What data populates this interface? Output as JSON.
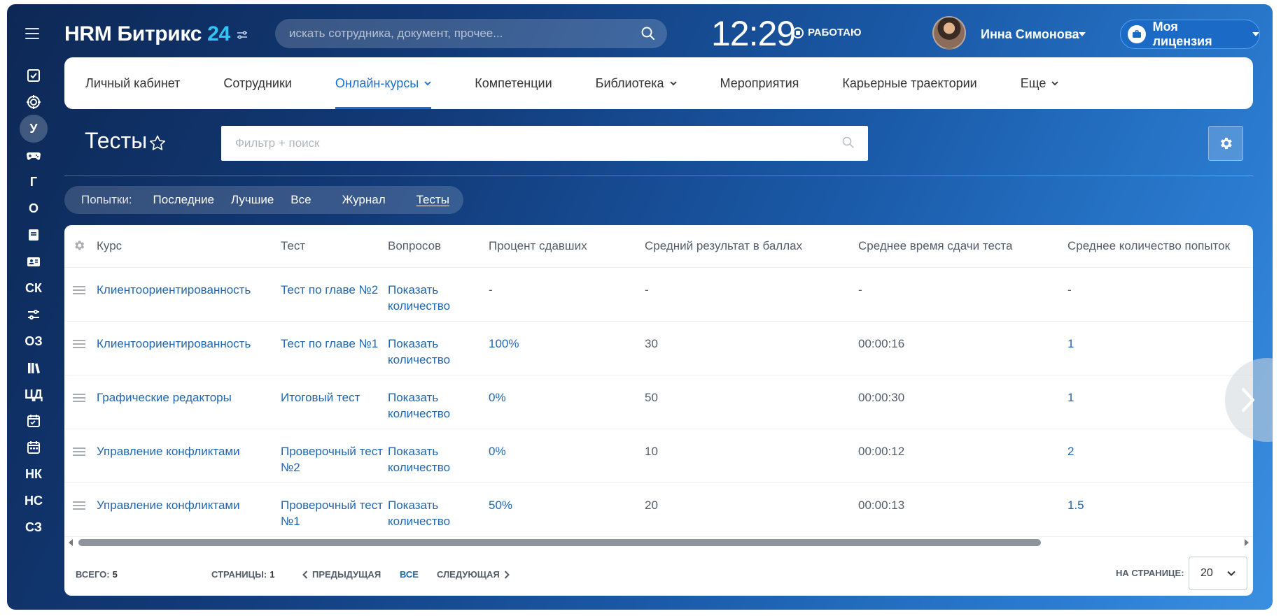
{
  "header": {
    "logo_text": "HRM Битрикс",
    "logo_num": "24",
    "search_placeholder": "искать сотрудника, документ, прочее...",
    "clock": "12:29",
    "work_status": "РАБОТАЮ",
    "user_name": "Инна Симонова",
    "license": "Моя лицензия"
  },
  "sidebar": {
    "items": [
      {
        "type": "icon",
        "icon": "checkbox-icon"
      },
      {
        "type": "icon",
        "icon": "target-icon"
      },
      {
        "type": "text",
        "label": "У",
        "active": true
      },
      {
        "type": "icon",
        "icon": "gamepad-icon"
      },
      {
        "type": "text",
        "label": "Г"
      },
      {
        "type": "text",
        "label": "О"
      },
      {
        "type": "icon",
        "icon": "document-icon"
      },
      {
        "type": "icon",
        "icon": "id-card-icon"
      },
      {
        "type": "text",
        "label": "СК"
      },
      {
        "type": "icon",
        "icon": "sliders-icon"
      },
      {
        "type": "text",
        "label": "ОЗ"
      },
      {
        "type": "icon",
        "icon": "library-icon"
      },
      {
        "type": "text",
        "label": "ЦД"
      },
      {
        "type": "icon",
        "icon": "calendar-check-icon"
      },
      {
        "type": "icon",
        "icon": "calendar-icon"
      },
      {
        "type": "text",
        "label": "НК"
      },
      {
        "type": "text",
        "label": "НС"
      },
      {
        "type": "text",
        "label": "СЗ"
      }
    ]
  },
  "nav": {
    "items": [
      {
        "label": "Личный кабинет",
        "dropdown": false
      },
      {
        "label": "Сотрудники",
        "dropdown": false
      },
      {
        "label": "Онлайн-курсы",
        "dropdown": true,
        "active": true
      },
      {
        "label": "Компетенции",
        "dropdown": false
      },
      {
        "label": "Библиотека",
        "dropdown": true
      },
      {
        "label": "Мероприятия",
        "dropdown": false
      },
      {
        "label": "Карьерные траектории",
        "dropdown": false
      },
      {
        "label": "Еще",
        "dropdown": true
      }
    ]
  },
  "page": {
    "title": "Тесты",
    "filter_placeholder": "Фильтр + поиск"
  },
  "subtabs": {
    "label": "Попытки:",
    "group1": [
      "Последние",
      "Лучшие",
      "Все"
    ],
    "journal": "Журнал",
    "tests": "Тесты"
  },
  "table": {
    "columns": [
      "Курс",
      "Тест",
      "Вопросов",
      "Процент сдавших",
      "Средний результат в баллах",
      "Среднее время сдачи теста",
      "Среднее количество попыток"
    ],
    "rows": [
      {
        "course": "Клиентоориентированность",
        "test": "Тест по главе №2",
        "questions": "Показать количество",
        "percent": "-",
        "score": "-",
        "time": "-",
        "attempts": "-",
        "linked": false
      },
      {
        "course": "Клиентоориентированность",
        "test": "Тест по главе №1",
        "questions": "Показать количество",
        "percent": "100%",
        "score": "30",
        "time": "00:00:16",
        "attempts": "1",
        "linked": true
      },
      {
        "course": "Графические редакторы",
        "test": "Итоговый тест",
        "questions": "Показать количество",
        "percent": "0%",
        "score": "50",
        "time": "00:00:30",
        "attempts": "1",
        "linked": true
      },
      {
        "course": "Управление конфликтами",
        "test": "Проверочный тест №2",
        "questions": "Показать количество",
        "percent": "0%",
        "score": "10",
        "time": "00:00:12",
        "attempts": "2",
        "linked": true
      },
      {
        "course": "Управление конфликтами",
        "test": "Проверочный тест №1",
        "questions": "Показать количество",
        "percent": "50%",
        "score": "20",
        "time": "00:00:13",
        "attempts": "1.5",
        "linked": true
      }
    ]
  },
  "footer": {
    "total_label": "ВСЕГО:",
    "total_value": "5",
    "pages_label": "СТРАНИЦЫ:",
    "pages_value": "1",
    "prev": "ПРЕДЫДУЩАЯ",
    "all": "ВСЕ",
    "next": "СЛЕДУЮЩАЯ",
    "per_page_label": "НА СТРАНИЦЕ:",
    "per_page_value": "20"
  },
  "colors": {
    "accent": "#1a6fd1",
    "link": "#2067b0",
    "logo_num": "#2fc6f6"
  }
}
